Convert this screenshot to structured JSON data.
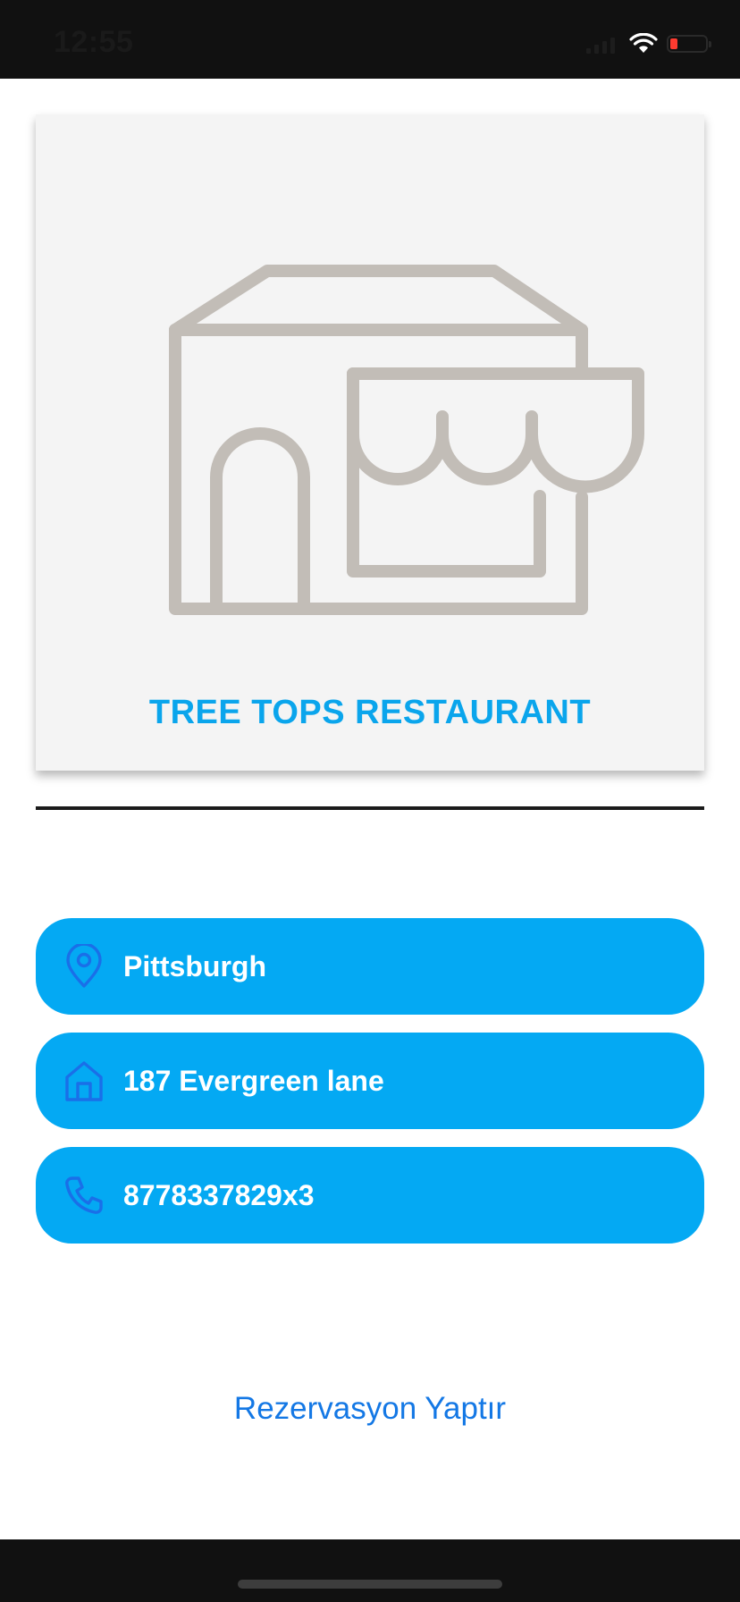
{
  "status_bar": {
    "time": "12:55",
    "battery_level": 0.2,
    "battery_color": "#ff3b30"
  },
  "restaurant": {
    "image_icon": "storefront-icon",
    "name": "TREE TOPS RESTAURANT"
  },
  "details": [
    {
      "icon": "location-pin-icon",
      "label": "Pittsburgh"
    },
    {
      "icon": "home-icon",
      "label": "187 Evergreen lane"
    },
    {
      "icon": "phone-icon",
      "label": "8778337829x3"
    }
  ],
  "actions": {
    "reserve_label": "Rezervasyon Yaptır"
  },
  "colors": {
    "accent": "#04a9f3",
    "title": "#0aa5ec",
    "link": "#1478e5",
    "icon_stroke": "#1a6fe8",
    "illustration": "#c2bdb7"
  }
}
